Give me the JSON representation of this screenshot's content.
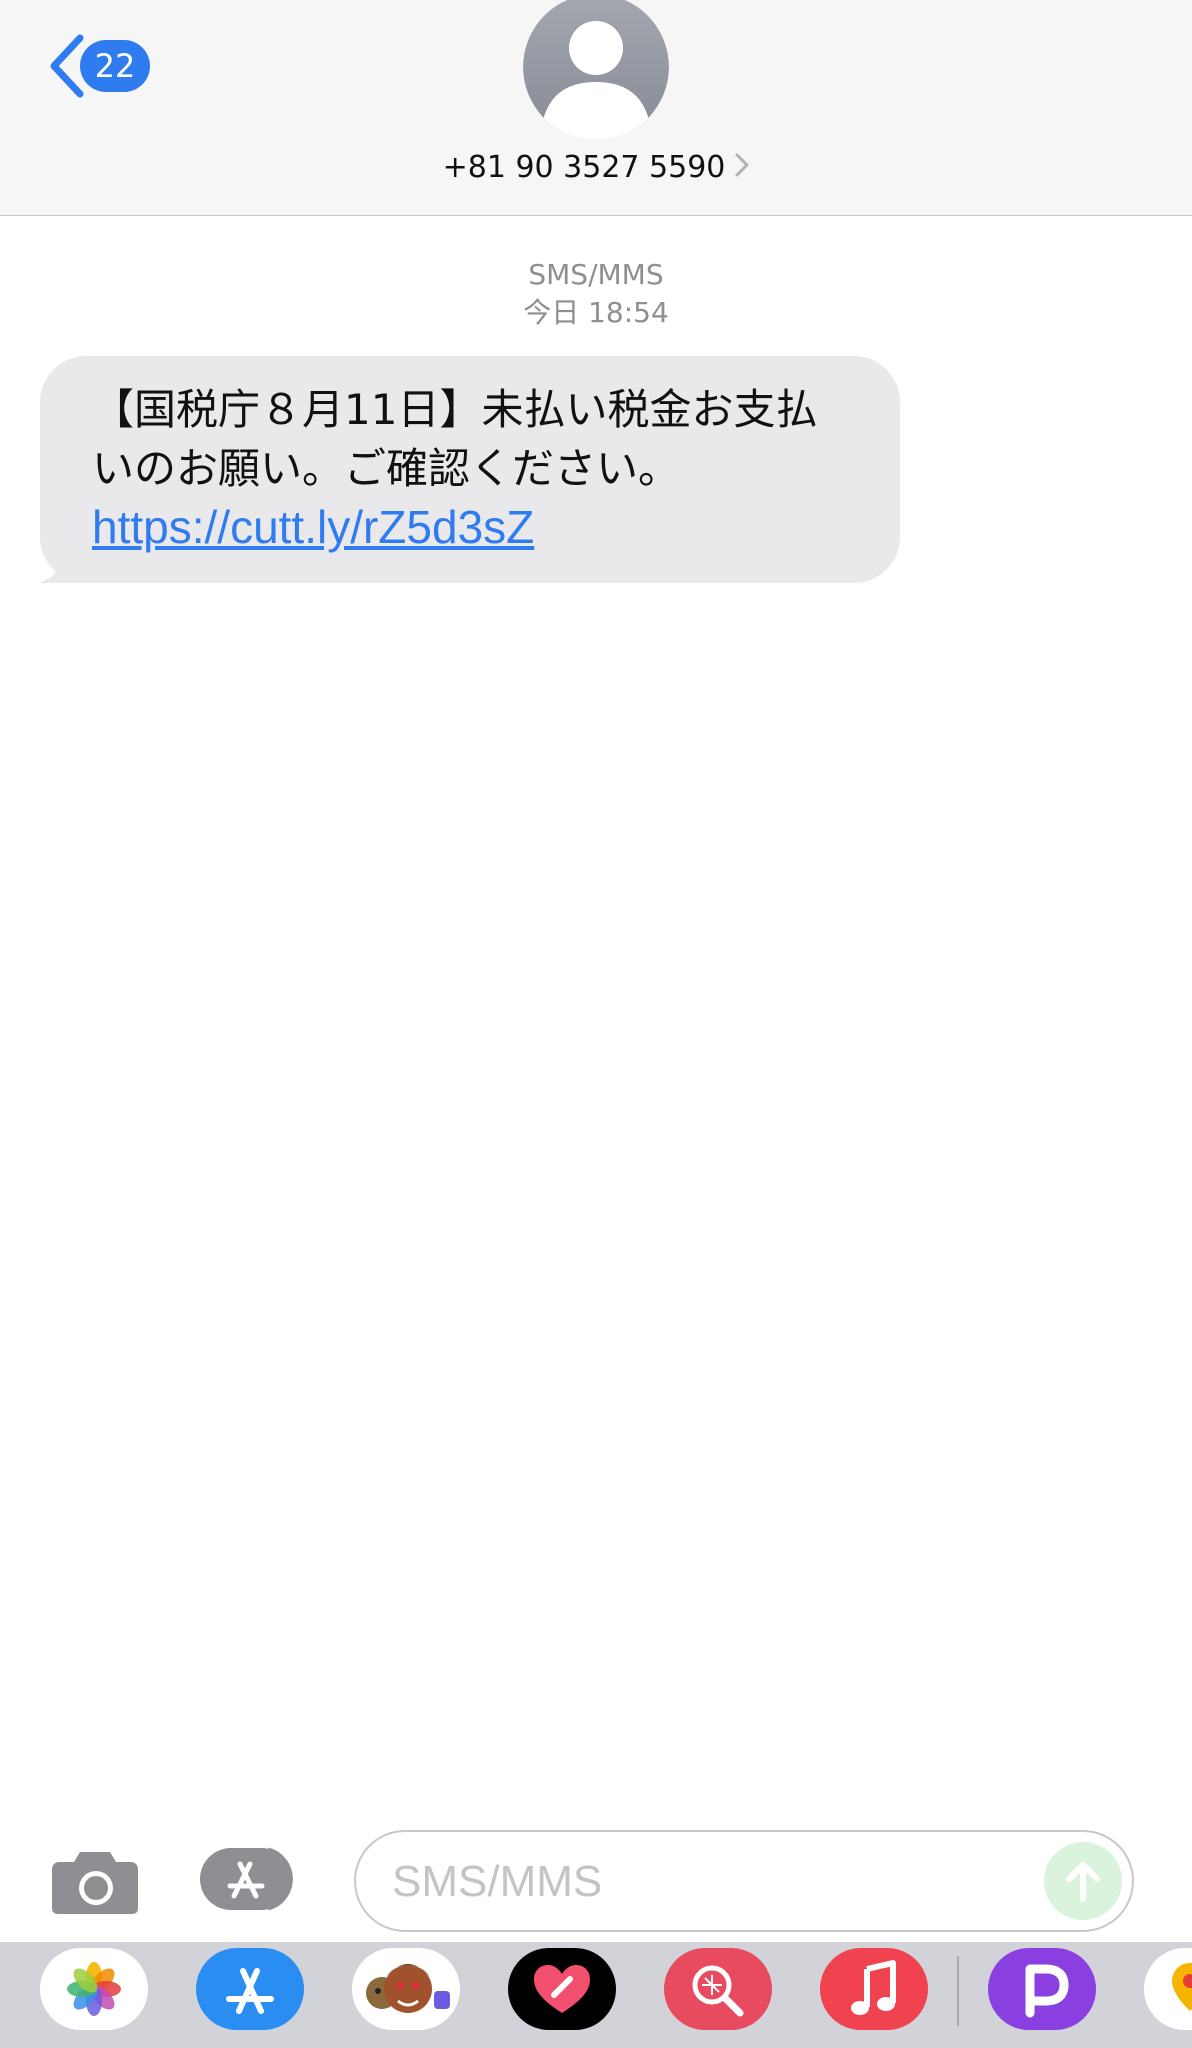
{
  "header": {
    "back_badge_count": "22",
    "contact_number": "+81 90 3527 5590"
  },
  "thread": {
    "service_label": "SMS/MMS",
    "timestamp": "今日 18:54",
    "messages": [
      {
        "direction": "incoming",
        "lines": [
          "【国税庁８月11日】未払い税金お支払",
          "いのお願い。ご確認ください。"
        ],
        "link": "https://cutt.ly/rZ5d3sZ"
      }
    ]
  },
  "composer": {
    "placeholder": "SMS/MMS"
  },
  "app_drawer": {
    "apps": [
      "photos-app",
      "app-store-app",
      "memoji-app",
      "heart-app",
      "search-app",
      "music-app",
      "p-app",
      "maps-app"
    ]
  },
  "colors": {
    "accent": "#2f7bf0",
    "bubble_incoming": "#e9e9eb",
    "header_bg": "#f6f6f6",
    "drawer_bg": "#d1d3d9",
    "send_disabled": "#d9f3dd"
  }
}
